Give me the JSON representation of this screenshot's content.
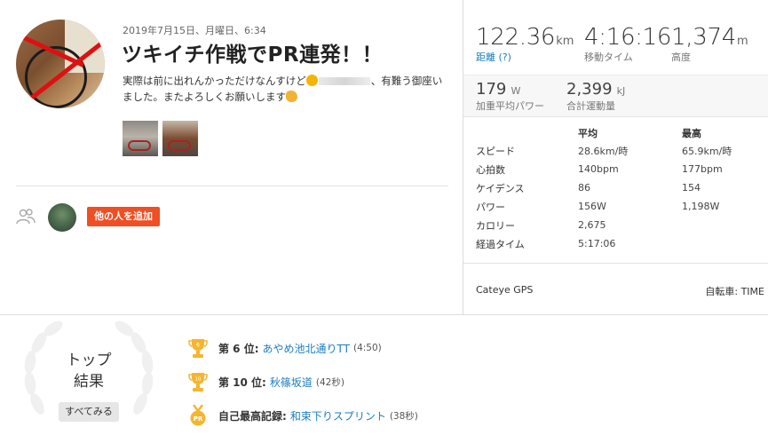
{
  "activity": {
    "date": "2019年7月15日、月曜日、6:34",
    "title": "ツキイチ作戦でPR連発！！",
    "desc_part1": "実際は前に出れんかっただけなんすけど",
    "desc_part2": "、有難う御座いました。またよろしくお願いします"
  },
  "kudos": {
    "add_label": "他の人を追加"
  },
  "stats": {
    "distance": {
      "value": "122.36",
      "unit": "km",
      "label": "距離",
      "help": "(?)"
    },
    "moving_time": {
      "value": "4:16:16",
      "label": "移動タイム"
    },
    "elevation": {
      "value": "1,374",
      "unit": "m",
      "label": "高度"
    },
    "weighted_power": {
      "value": "179",
      "unit": "W",
      "label": "加重平均パワー"
    },
    "total_work": {
      "value": "2,399",
      "unit": "kJ",
      "label": "合計運動量"
    }
  },
  "more_table": {
    "headers": [
      "",
      "平均",
      "最高"
    ],
    "rows": [
      [
        "スピード",
        "28.6km/時",
        "65.9km/時"
      ],
      [
        "心拍数",
        "140bpm",
        "177bpm"
      ],
      [
        "ケイデンス",
        "86",
        "154"
      ],
      [
        "パワー",
        "156W",
        "1,198W"
      ],
      [
        "カロリー",
        "2,675",
        ""
      ],
      [
        "経過タイム",
        "5:17:06",
        ""
      ]
    ]
  },
  "device": "Cateye GPS",
  "bike": "自転車: TIME",
  "top_results": {
    "label_line1": "トップ",
    "label_line2": "結果",
    "see_all": "すべてみる",
    "items": [
      {
        "icon": "trophy-icon",
        "badge": "6",
        "rank": "第 6 位:",
        "segment": "あやめ池北通りTT",
        "time": "(4:50)"
      },
      {
        "icon": "trophy-icon",
        "badge": "10",
        "rank": "第 10 位:",
        "segment": "秋篠坂道",
        "time": "(42秒)"
      },
      {
        "icon": "pr-medal-icon",
        "badge": "PR",
        "rank": "自己最高記録:",
        "segment": "和束下りスプリント",
        "time": "(38秒)"
      }
    ]
  },
  "colors": {
    "accent": "#f04e23",
    "link": "#1a7dc1",
    "trophy": "#f5b52e"
  }
}
